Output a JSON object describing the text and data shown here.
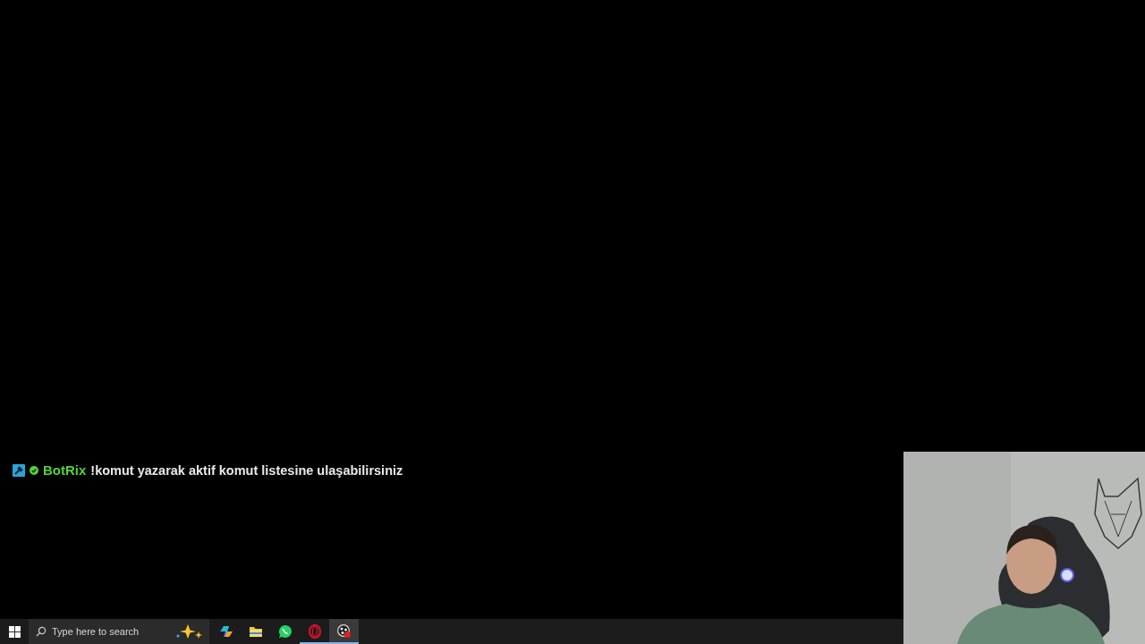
{
  "chat": {
    "username": "BotRix",
    "message": "!komut yazarak aktif komut listesine ulaşabilirsiniz"
  },
  "taskbar": {
    "search": {
      "placeholder": "Type here to search"
    },
    "apps": [
      {
        "kind": "copilot",
        "selected": false,
        "running": false
      },
      {
        "kind": "folder",
        "selected": false,
        "running": false
      },
      {
        "kind": "whatsapp",
        "selected": false,
        "running": false
      },
      {
        "kind": "opera",
        "selected": false,
        "running": true
      },
      {
        "kind": "obs",
        "selected": true,
        "running": true
      }
    ]
  }
}
